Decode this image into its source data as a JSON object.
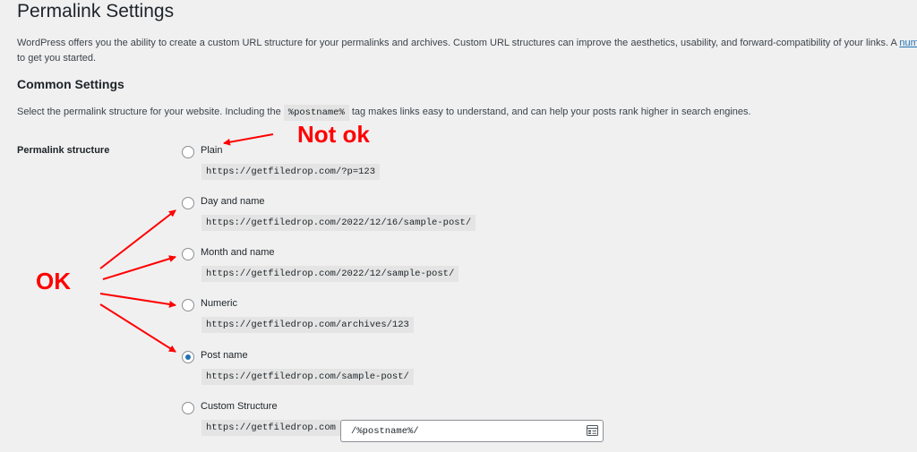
{
  "page": {
    "title": "Permalink Settings"
  },
  "intro": {
    "text": "WordPress offers you the ability to create a custom URL structure for your permalinks and archives. Custom URL structures can improve the aesthetics, usability, and forward-compatibility of your links. A ",
    "link": "numbe",
    "text2": "to get you started."
  },
  "common": {
    "title": "Common Settings",
    "desc_before": "Select the permalink structure for your website. Including the ",
    "tag": "%postname%",
    "desc_after": " tag makes links easy to understand, and can help your posts rank higher in search engines."
  },
  "structure_label": "Permalink structure",
  "options": [
    {
      "label": "Plain",
      "example": "https://getfiledrop.com/?p=123",
      "checked": false
    },
    {
      "label": "Day and name",
      "example": "https://getfiledrop.com/2022/12/16/sample-post/",
      "checked": false
    },
    {
      "label": "Month and name",
      "example": "https://getfiledrop.com/2022/12/sample-post/",
      "checked": false
    },
    {
      "label": "Numeric",
      "example": "https://getfiledrop.com/archives/123",
      "checked": false
    },
    {
      "label": "Post name",
      "example": "https://getfiledrop.com/sample-post/",
      "checked": true
    },
    {
      "label": "Custom Structure",
      "example": "https://getfiledrop.com",
      "checked": false
    }
  ],
  "custom_input": {
    "value": "/%postname%/"
  },
  "annotations": {
    "not_ok": "Not ok",
    "ok": "OK"
  },
  "colors": {
    "accent": "#2271b1",
    "annotation": "#ff0000",
    "background": "#f0f0f1"
  },
  "icons": {
    "custom_input": "tag-list-icon"
  }
}
